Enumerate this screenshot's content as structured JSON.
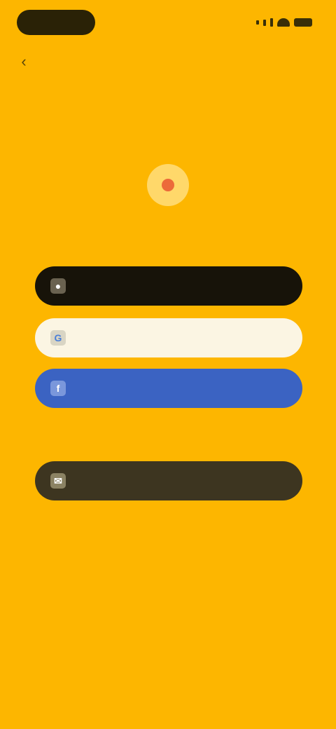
{
  "status_bar": {
    "time": "",
    "icons": [
      "signal-icon",
      "wifi-icon",
      "battery-icon"
    ]
  },
  "nav": {
    "back_icon": "back-arrow-icon"
  },
  "brand": {
    "logo_icon": "app-logo-icon",
    "name": ""
  },
  "auth_buttons": {
    "apple": {
      "label": "",
      "icon": "apple-icon"
    },
    "google": {
      "label": "",
      "icon": "google-icon"
    },
    "facebook": {
      "label": "",
      "icon": "facebook-icon"
    },
    "email": {
      "label": "",
      "icon": "mail-icon"
    }
  },
  "divider": {
    "text": ""
  },
  "footer": {
    "terms_link": "",
    "legal_text": ""
  },
  "colors": {
    "background": "#FDB600",
    "apple_button": "#171309",
    "google_button": "#fbf5e3",
    "facebook_button": "#3b63c2",
    "email_button": "#3d3520"
  }
}
